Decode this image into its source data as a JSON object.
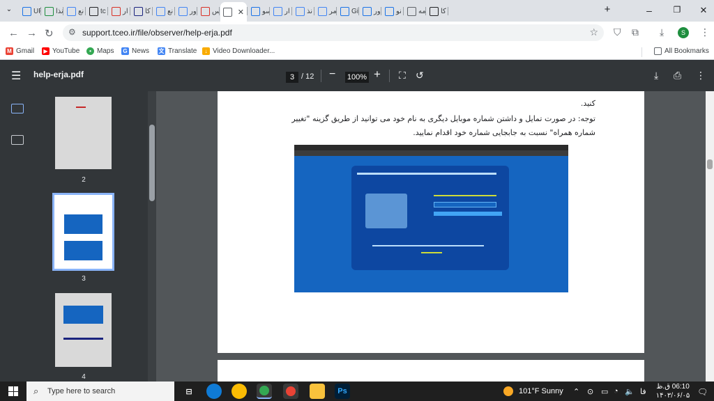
{
  "browser": {
    "tabs": [
      {
        "label": "UF",
        "icon": "doc-icon",
        "color": "#1a73e8"
      },
      {
        "label": "نذا",
        "icon": "green-plus-icon",
        "color": "#1e8e3e"
      },
      {
        "label": "نع",
        "icon": "google-icon",
        "color": "#4285f4"
      },
      {
        "label": "tc",
        "icon": "graph-icon",
        "color": "#202124"
      },
      {
        "label": "ار",
        "icon": "pen-icon",
        "color": "#d93025"
      },
      {
        "label": "کا",
        "icon": "s-icon",
        "color": "#1a237e"
      },
      {
        "label": "نع",
        "icon": "google-icon",
        "color": "#4285f4"
      },
      {
        "label": "ور",
        "icon": "google-icon",
        "color": "#4285f4"
      },
      {
        "label": "س",
        "icon": "mail-icon",
        "color": "#d93025"
      },
      {
        "label": "",
        "icon": "globe-icon",
        "color": "#5f6368",
        "active": true
      },
      {
        "label": "سو",
        "icon": "mail-icon",
        "color": "#1a73e8"
      },
      {
        "label": "ار",
        "icon": "google-icon",
        "color": "#4285f4"
      },
      {
        "label": "نذ",
        "icon": "google-icon",
        "color": "#4285f4"
      },
      {
        "label": "مر",
        "icon": "google-icon",
        "color": "#4285f4"
      },
      {
        "label": "Gi",
        "icon": "gemini-icon",
        "color": "#1a73e8"
      },
      {
        "label": "ور",
        "icon": "a-icon",
        "color": "#1a73e8"
      },
      {
        "label": "نو",
        "icon": "a-icon",
        "color": "#1a73e8"
      },
      {
        "label": "مه",
        "icon": "globe-icon",
        "color": "#5f6368"
      },
      {
        "label": "کا",
        "icon": "chat-icon",
        "color": "#202124"
      }
    ],
    "url": "support.tceo.ir/file/observer/help-erja.pdf",
    "profile_initial": "S",
    "bookmarks": [
      "Gmail",
      "YouTube",
      "Maps",
      "News",
      "Translate",
      "Video Downloader..."
    ],
    "all_bookmarks": "All Bookmarks"
  },
  "pdf": {
    "title": "help-erja.pdf",
    "current_page": "3",
    "total_pages": "/ 12",
    "zoom": "100%",
    "thumbnails": [
      {
        "label": "2"
      },
      {
        "label": "3",
        "selected": true
      },
      {
        "label": "4"
      }
    ],
    "content": {
      "line0": "کنید.",
      "note_line1": "توجه: در صورت تمایل و داشتن شماره موبایل دیگری به نام خود می توانید از طریق گزینه \"تغییر",
      "note_line2": "شماره همراه\" نسبت به جابجایی شماره خود اقدام نمایید."
    }
  },
  "taskbar": {
    "search_placeholder": "Type here to search",
    "weather": "101°F  Sunny",
    "lang": "فا",
    "time": "06:10 ق.ظ",
    "date": "۱۴۰۳/۰۶/۰۵"
  },
  "colors": {
    "accent": "#8ab4f8",
    "pdf_toolbar": "#323639",
    "viewer_bg": "#525659"
  }
}
